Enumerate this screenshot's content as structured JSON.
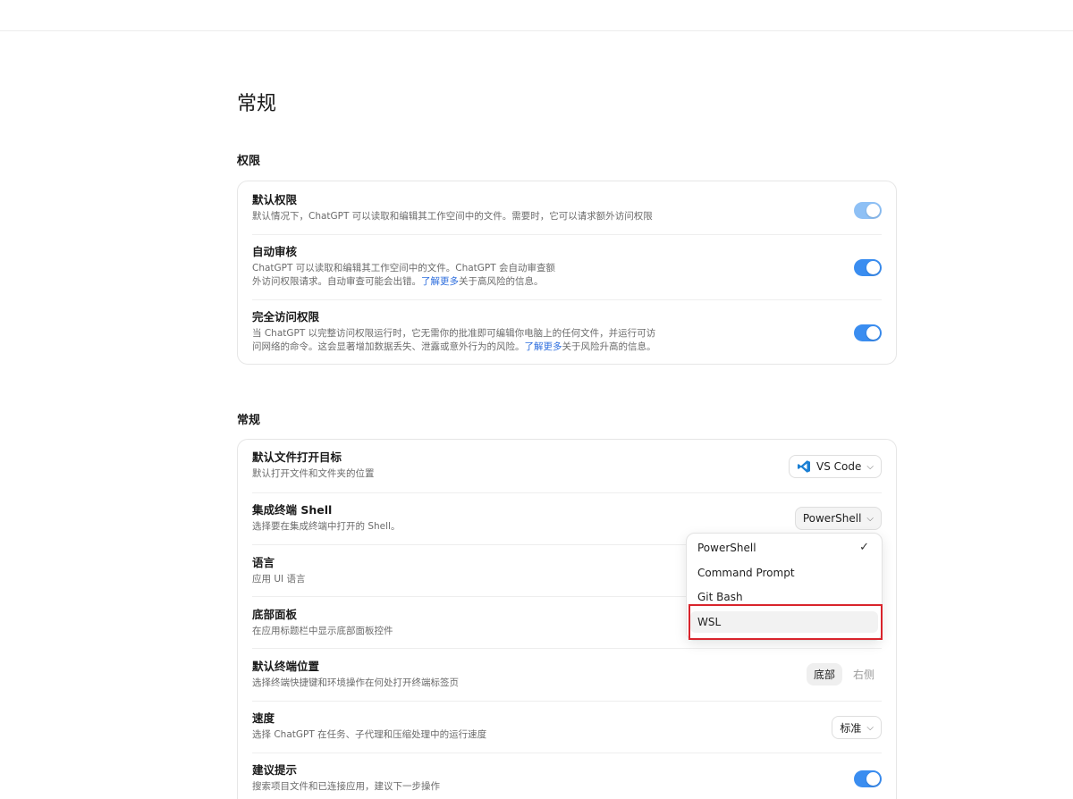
{
  "page": {
    "title": "常规"
  },
  "permissions": {
    "section_title": "权限",
    "items": [
      {
        "title": "默认权限",
        "desc": "默认情况下，ChatGPT 可以读取和编辑其工作空间中的文件。需要时，它可以请求额外访问权限",
        "toggle_on": true
      },
      {
        "title": "自动审核",
        "desc_line1": "ChatGPT 可以读取和编辑其工作空间中的文件。ChatGPT 会自动审查额",
        "desc_line2_pre": "外访问权限请求。自动审查可能会出错。",
        "link": "了解更多",
        "desc_line2_post": "关于高风险的信息。",
        "toggle_on": true
      },
      {
        "title": "完全访问权限",
        "desc_line1": "当 ChatGPT 以完整访问权限运行时，它无需你的批准即可编辑你电脑上的任何文件，并运行可访",
        "desc_line2_pre": "问网络的命令。这会显著增加数据丢失、泄露或意外行为的风险。",
        "link": "了解更多",
        "desc_line2_post": "关于风险升高的信息。",
        "toggle_on": true
      }
    ]
  },
  "general": {
    "section_title": "常规",
    "file_target": {
      "title": "默认文件打开目标",
      "desc": "默认打开文件和文件夹的位置",
      "value": "VS Code"
    },
    "shell": {
      "title": "集成终端 Shell",
      "desc": "选择要在集成终端中打开的 Shell。",
      "value": "PowerShell"
    },
    "language": {
      "title": "语言",
      "desc": "应用 UI 语言"
    },
    "bottom_panel": {
      "title": "底部面板",
      "desc": "在应用标题栏中显示底部面板控件"
    },
    "terminal_position": {
      "title": "默认终端位置",
      "desc": "选择终端快捷键和环境操作在何处打开终端标签页",
      "options": [
        "底部",
        "右侧"
      ],
      "selected": "底部"
    },
    "speed": {
      "title": "速度",
      "desc": "选择 ChatGPT 在任务、子代理和压缩处理中的运行速度",
      "value": "标准"
    },
    "suggestions": {
      "title": "建议提示",
      "desc": "搜索项目文件和已连接应用，建议下一步操作",
      "toggle_on": true
    }
  },
  "shell_dropdown": {
    "options": [
      "PowerShell",
      "Command Prompt",
      "Git Bash",
      "WSL"
    ],
    "selected": "PowerShell",
    "highlighted": "WSL"
  },
  "colors": {
    "accent": "#3a8df0",
    "highlight_border": "#d9242c",
    "link": "#2f6fde"
  }
}
